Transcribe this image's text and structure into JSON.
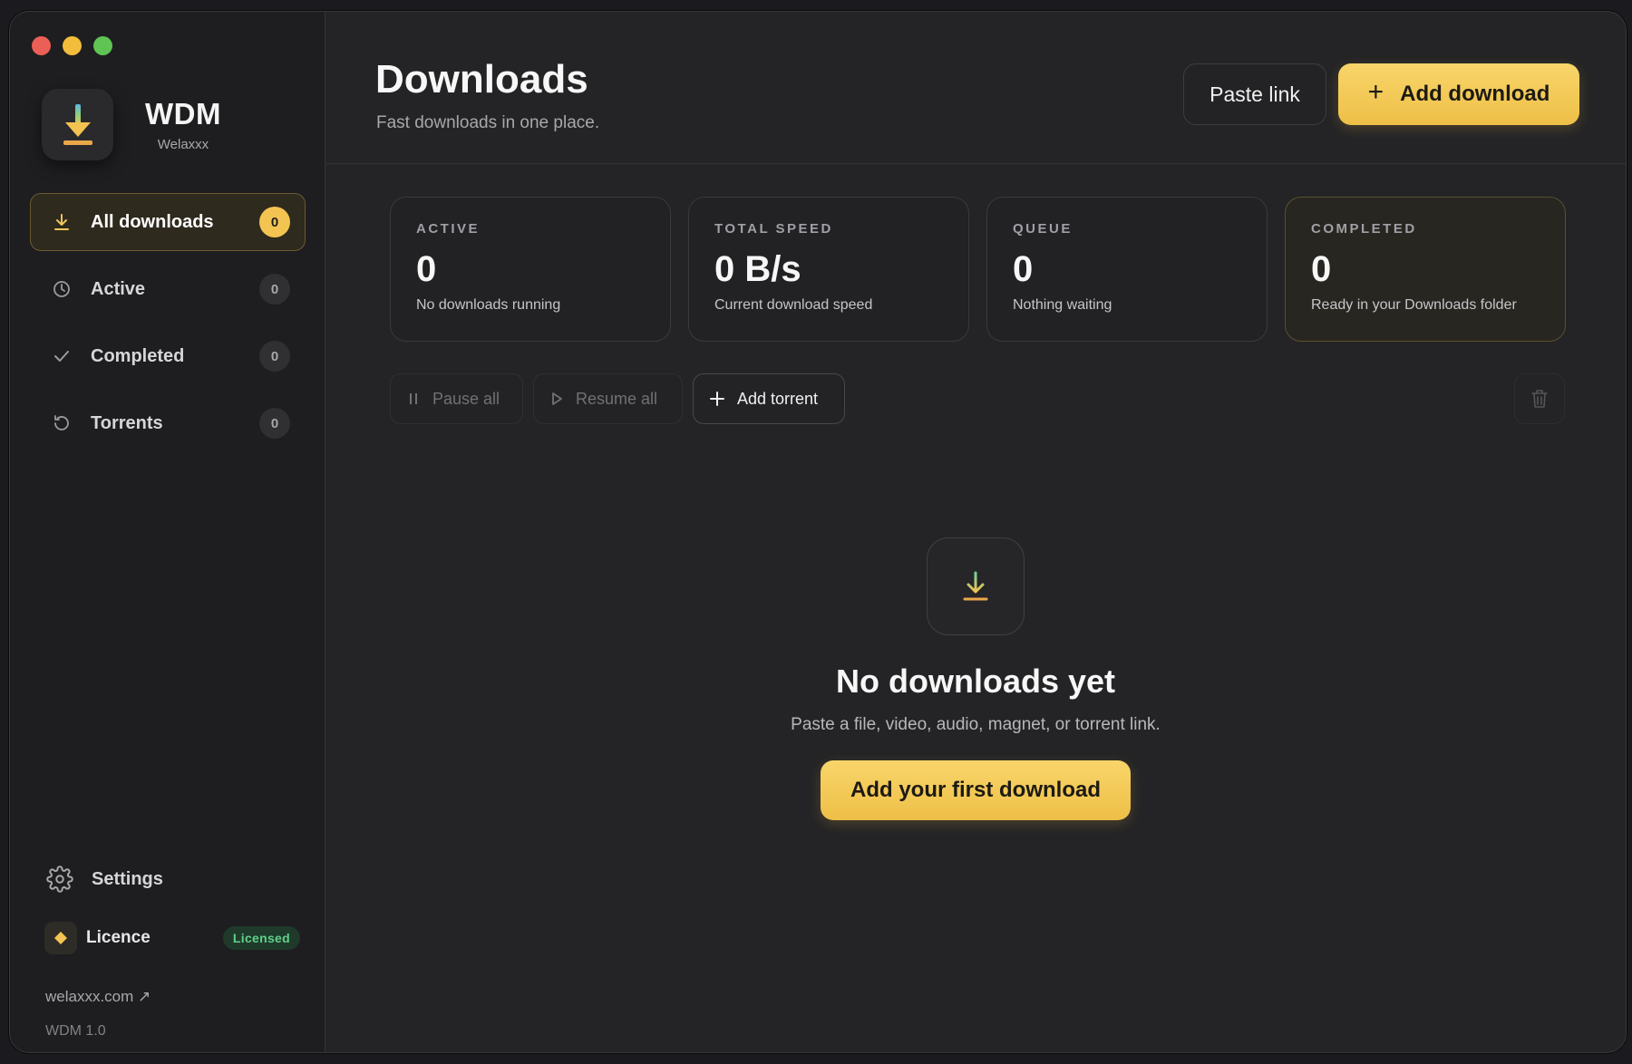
{
  "app": {
    "name": "WDM",
    "subtitle": "Welaxxx"
  },
  "sidebar": {
    "items": [
      {
        "label": "All downloads",
        "count": "0",
        "icon": "download-icon",
        "active": true
      },
      {
        "label": "Active",
        "count": "0",
        "icon": "clock-icon"
      },
      {
        "label": "Completed",
        "count": "0",
        "icon": "check-icon"
      },
      {
        "label": "Torrents",
        "count": "0",
        "icon": "refresh-icon"
      }
    ],
    "settings_label": "Settings",
    "licence_label": "Licence",
    "licence_badge": "Licensed",
    "site_link": "welaxxx.com ↗",
    "version": "WDM 1.0"
  },
  "header": {
    "title": "Downloads",
    "subtitle": "Fast downloads in one place.",
    "paste_label": "Paste link",
    "add_label": "Add download"
  },
  "stats": [
    {
      "label": "ACTIVE",
      "value": "0",
      "desc": "No downloads running"
    },
    {
      "label": "TOTAL SPEED",
      "value": "0 B/s",
      "desc": "Current download speed"
    },
    {
      "label": "QUEUE",
      "value": "0",
      "desc": "Nothing waiting"
    },
    {
      "label": "COMPLETED",
      "value": "0",
      "desc": "Ready in your Downloads folder"
    }
  ],
  "toolbar": {
    "pause_label": "Pause all",
    "resume_label": "Resume all",
    "torrent_label": "Add torrent"
  },
  "empty_state": {
    "title": "No downloads yet",
    "subtitle": "Paste a file, video, audio, magnet, or torrent link.",
    "button_label": "Add your first download"
  },
  "colors": {
    "accent": "#f3c451",
    "licensed": "#5fcf8a",
    "background": "#242426"
  }
}
